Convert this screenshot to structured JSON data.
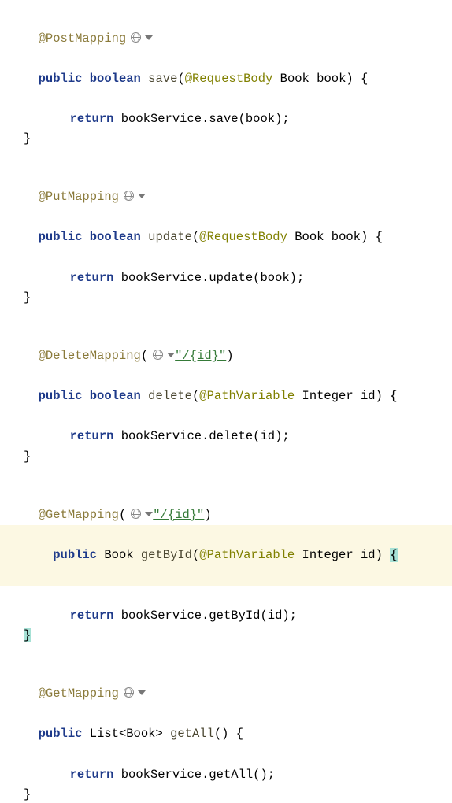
{
  "code": {
    "post": {
      "anno": "@PostMapping",
      "sig1": "public",
      "sig2": "boolean",
      "method": "save",
      "paramAnno": "@RequestBody",
      "paramType": "Book",
      "paramName": "book",
      "ret": "return",
      "svc": "bookService",
      "call": ".save(book);"
    },
    "put": {
      "anno": "@PutMapping",
      "sig1": "public",
      "sig2": "boolean",
      "method": "update",
      "paramAnno": "@RequestBody",
      "paramType": "Book",
      "paramName": "book",
      "ret": "return",
      "svc": "bookService",
      "call": ".update(book);"
    },
    "del": {
      "anno": "@DeleteMapping",
      "path": "\"/{id}\"",
      "sig1": "public",
      "sig2": "boolean",
      "method": "delete",
      "paramAnno": "@PathVariable",
      "paramType": "Integer",
      "paramName": "id",
      "ret": "return",
      "svc": "bookService",
      "call": ".delete(id);"
    },
    "getById": {
      "anno": "@GetMapping",
      "path": "\"/{id}\"",
      "sig1": "public",
      "retType": "Book",
      "method": "getById",
      "paramAnno": "@PathVariable",
      "paramType": "Integer",
      "paramName": "id",
      "ret": "return",
      "svc": "bookService",
      "call": ".getById(id);"
    },
    "getAll": {
      "anno": "@GetMapping",
      "sig1": "public",
      "retType": "List<Book>",
      "method": "getAll",
      "ret": "return",
      "svc": "bookService",
      "call": ".getAll();"
    }
  }
}
